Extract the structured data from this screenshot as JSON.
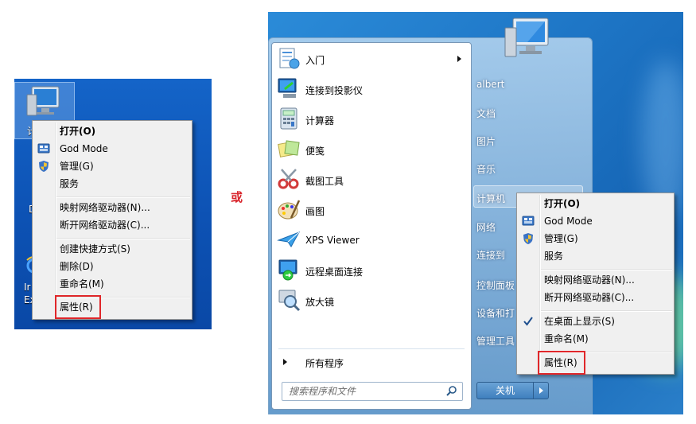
{
  "connector": "或",
  "desktop_menu": {
    "items": [
      {
        "label": "打开(O)",
        "bold": true
      },
      {
        "label": "God Mode"
      },
      {
        "label": "管理(G)"
      },
      {
        "label": "服务"
      },
      {
        "label": "映射网络驱动器(N)..."
      },
      {
        "label": "断开网络驱动器(C)..."
      },
      {
        "label": "创建快捷方式(S)"
      },
      {
        "label": "删除(D)"
      },
      {
        "label": "重命名(M)"
      },
      {
        "label": "属性(R)",
        "highlighted": true
      }
    ],
    "desktop_labels": [
      "计",
      "D",
      "Ir",
      "Ex"
    ]
  },
  "start_menu": {
    "programs": [
      {
        "label": "入门",
        "icon": "getting-started-icon",
        "submenu": true
      },
      {
        "label": "连接到投影仪",
        "icon": "projector-icon"
      },
      {
        "label": "计算器",
        "icon": "calculator-icon"
      },
      {
        "label": "便笺",
        "icon": "sticky-notes-icon"
      },
      {
        "label": "截图工具",
        "icon": "snipping-tool-icon"
      },
      {
        "label": "画图",
        "icon": "paint-icon"
      },
      {
        "label": "XPS Viewer",
        "icon": "xps-viewer-icon"
      },
      {
        "label": "远程桌面连接",
        "icon": "remote-desktop-icon"
      },
      {
        "label": "放大镜",
        "icon": "magnifier-icon"
      }
    ],
    "all_programs": "所有程序",
    "search_placeholder": "搜索程序和文件",
    "right_links": [
      "albert",
      "文档",
      "图片",
      "音乐",
      "计算机",
      "网络",
      "连接到",
      "控制面板",
      "设备和打",
      "管理工具"
    ],
    "shutdown_label": "关机"
  },
  "computer_menu": {
    "items": [
      {
        "label": "打开(O)",
        "bold": true
      },
      {
        "label": "God Mode"
      },
      {
        "label": "管理(G)"
      },
      {
        "label": "服务"
      },
      {
        "label": "映射网络驱动器(N)..."
      },
      {
        "label": "断开网络驱动器(C)..."
      },
      {
        "label": "在桌面上显示(S)",
        "checked": true
      },
      {
        "label": "重命名(M)"
      },
      {
        "label": "属性(R)",
        "highlighted": true
      }
    ]
  },
  "colors": {
    "highlight": "#e0272a",
    "connector": "#d9272e",
    "desktop_bg": "#0d52b4"
  }
}
